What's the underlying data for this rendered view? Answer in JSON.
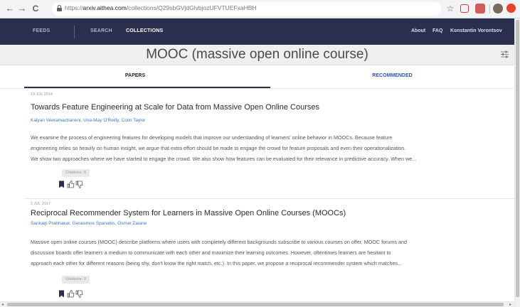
{
  "browser": {
    "url_prefix": "https://",
    "url_host": "arxiv.aithea.com",
    "url_path": "/collections/Q29sbGVjdGlvbjozUFVTUEFxaHBH",
    "back_glyph": "←",
    "forward_glyph": "→",
    "reload_glyph": "C",
    "star_glyph": "☆"
  },
  "navbar": {
    "items": [
      "FEEDS",
      "SEARCH",
      "COLLECTIONS"
    ],
    "right": [
      "About",
      "FAQ",
      "Konstantin Vorontsov"
    ]
  },
  "page": {
    "title": "MOOC (massive open online course)"
  },
  "tabs": {
    "papers": "PAPERS",
    "recommended": "RECOMMENDED"
  },
  "papers": [
    {
      "date": "19 JUL 2014",
      "title": "Towards Feature Engineering at Scale for Data from Massive Open Online Courses",
      "authors": "Kalyan Veeramachaneni, Una-May O'Reilly, Colin Taylor",
      "abstract_lines": [
        "We examine the process of engineering features for developing models that improve our understanding of learners' online behavior in MOOCs. Because feature",
        "engineering relies so heavily on human insight, we argue that extra effort should be made to engage the crowd for feature proposals and even their operationalization.",
        "We show two approaches where we have started to engage the crowd. We also show how features can be evaluated for their relevance in predictive accuracy. When we..."
      ],
      "citations": "Citations: 6"
    },
    {
      "date": "2 JUL 2017",
      "title": "Reciprocal Recommender System for Learners in Massive Open Online Courses (MOOCs)",
      "authors": "Sankalp Prabhakar, Gerasimos Spanakis, Osmar Zaiane",
      "abstract_lines": [
        "Massive open online courses (MOOC) describe platforms where users with completely different backgrounds subscribe to various courses on offer. MOOC forums and",
        "discussion boards offer learners a medium to communicate with each other and maximize their learning outcomes. However, oftentimes learners are hesitant to",
        "approach each other for different reasons (being shy, don't know the right match, etc.). In this paper, we propose a reciprocal recommender system which matches..."
      ],
      "citations": "Citations: 0"
    }
  ],
  "colors": {
    "navbar": "#2b2f4d",
    "accent_link": "#3d77c7",
    "tab_active_underline": "#2b2f4d"
  }
}
